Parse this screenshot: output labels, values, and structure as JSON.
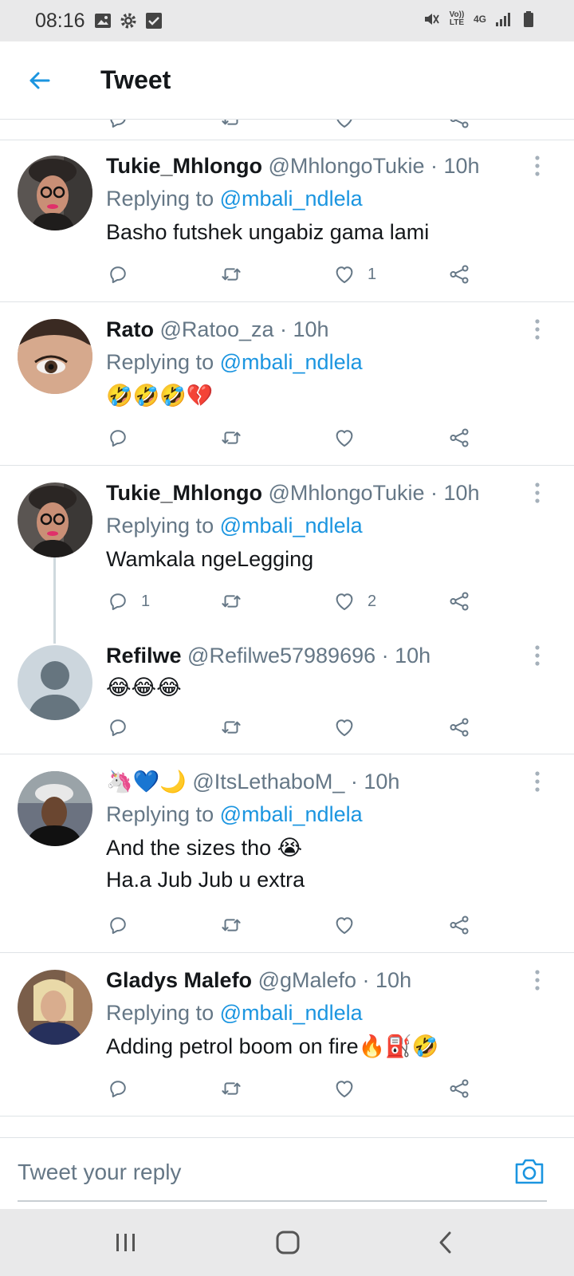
{
  "status_bar": {
    "time": "08:16",
    "left_icons": [
      "image-icon",
      "gear-icon",
      "checkbox-icon"
    ],
    "right_icons": [
      "mute-icon",
      "volte-icon",
      "4g-icon",
      "signal-icon",
      "battery-icon"
    ],
    "volte_label": "Vo)) LTE",
    "network_label": "4G"
  },
  "app_bar": {
    "title": "Tweet",
    "back_icon": "arrow-left-icon"
  },
  "colors": {
    "accent": "#1b95e0",
    "secondary_text": "#657786",
    "divider": "#dfe3e6"
  },
  "tweets": [
    {
      "name": "Tukie_Mhlongo",
      "meta": "@MhlongoTukie · 10h",
      "replying_prefix": "Replying to ",
      "replying_to": "@mbali_ndlela",
      "text": "Basho futshek ungabiz gama lami",
      "reply_count": "",
      "retweet_count": "",
      "like_count": "1"
    },
    {
      "name": "Rato",
      "meta": "@Ratoo_za · 10h",
      "replying_prefix": "Replying to ",
      "replying_to": "@mbali_ndlela",
      "text": "🤣🤣🤣💔",
      "reply_count": "",
      "retweet_count": "",
      "like_count": ""
    },
    {
      "name": "Tukie_Mhlongo",
      "meta": "@MhlongoTukie · 10h",
      "replying_prefix": "Replying to ",
      "replying_to": "@mbali_ndlela",
      "text": "Wamkala ngeLegging",
      "reply_count": "1",
      "retweet_count": "",
      "like_count": "2"
    },
    {
      "name": "Refilwe",
      "meta": "@Refilwe57989696 · 10h",
      "text": "😂😂😂",
      "reply_count": "",
      "retweet_count": "",
      "like_count": ""
    },
    {
      "name": "🦄💙🌙",
      "meta": "@ItsLethaboM_ · 10h",
      "replying_prefix": "Replying to ",
      "replying_to": "@mbali_ndlela",
      "text": "And the sizes tho 😭\nHa.a Jub Jub u extra",
      "reply_count": "",
      "retweet_count": "",
      "like_count": ""
    },
    {
      "name": "Gladys Malefo",
      "meta": "@gMalefo · 10h",
      "replying_prefix": "Replying to ",
      "replying_to": "@mbali_ndlela",
      "text": "Adding petrol boom on fire🔥⛽🤣",
      "reply_count": "",
      "retweet_count": "",
      "like_count": ""
    }
  ],
  "compose": {
    "placeholder": "Tweet your reply",
    "camera_icon": "camera-icon"
  },
  "nav_bar": {
    "icons": [
      "recent-apps-icon",
      "home-icon",
      "back-icon"
    ]
  }
}
